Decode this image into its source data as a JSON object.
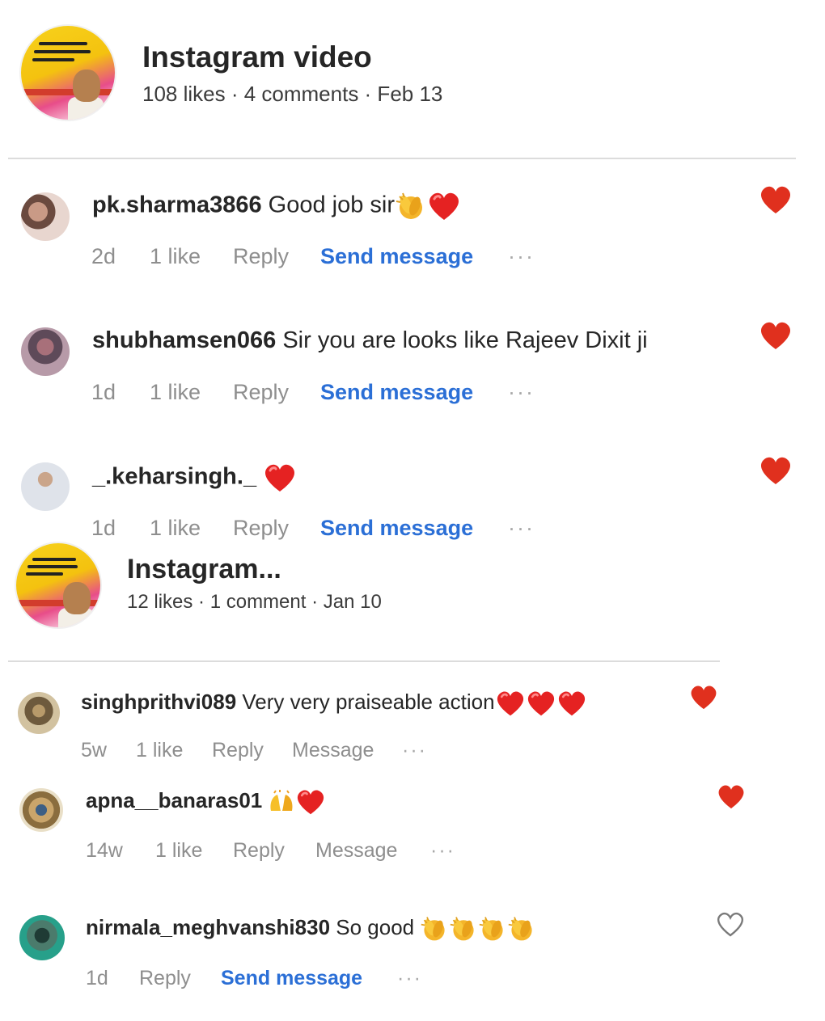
{
  "posts": [
    {
      "title": "Instagram video",
      "meta": "108 likes · 4 comments · Feb 13",
      "comments": [
        {
          "username": "pk.sharma3866",
          "text": "Good job sir",
          "emojis": [
            "clap-emoji",
            "red-heart-emoji"
          ],
          "time": "2d",
          "likes": "1 like",
          "reply": "Reply",
          "message": "Send message",
          "more": "···",
          "liked": true
        },
        {
          "username": "shubhamsen066",
          "text": "Sir you are looks like Rajeev Dixit ji",
          "emojis": [],
          "time": "1d",
          "likes": "1 like",
          "reply": "Reply",
          "message": "Send message",
          "more": "···",
          "liked": true
        },
        {
          "username": "_.keharsingh._",
          "text": "",
          "emojis": [
            "red-heart-emoji"
          ],
          "time": "1d",
          "likes": "1 like",
          "reply": "Reply",
          "message": "Send message",
          "more": "···",
          "liked": true
        }
      ]
    },
    {
      "title": "Instagram...",
      "meta": "12 likes · 1 comment · Jan 10",
      "comments": [
        {
          "username": "singhprithvi089",
          "text": "Very very praiseable action",
          "emojis": [
            "red-heart-emoji",
            "red-heart-emoji",
            "red-heart-emoji"
          ],
          "time": "5w",
          "likes": "1 like",
          "reply": "Reply",
          "message": "Message",
          "more": "···",
          "liked": true
        },
        {
          "username": "apna__banaras01",
          "text": "",
          "emojis": [
            "raising-hands-emoji",
            "red-heart-emoji"
          ],
          "time": "14w",
          "likes": "1 like",
          "reply": "Reply",
          "message": "Message",
          "more": "···",
          "liked": true
        },
        {
          "username": "nirmala_meghvanshi830",
          "text": "So good",
          "emojis": [
            "clap-emoji",
            "clap-emoji",
            "clap-emoji",
            "clap-emoji"
          ],
          "time": "1d",
          "likes": "",
          "reply": "Reply",
          "message": "Send message",
          "more": "···",
          "liked": false
        }
      ]
    }
  ],
  "colors": {
    "heart": "#e0301e",
    "link": "#2b6fd6",
    "meta": "#8e8e8e",
    "divider": "#dcdcdc"
  }
}
